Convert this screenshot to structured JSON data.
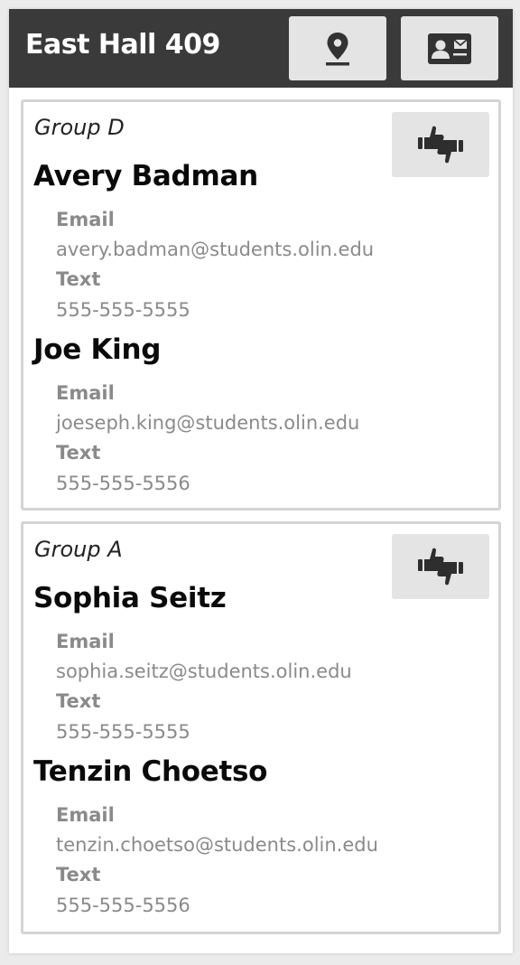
{
  "header": {
    "title": "East Hall 409",
    "buttons": [
      {
        "icon": "location-pin-icon"
      },
      {
        "icon": "contact-card-icon"
      }
    ]
  },
  "groups": [
    {
      "label": "Group D",
      "vote_icon": "thumbs-up-down-icon",
      "members": [
        {
          "name": "Avery Badman",
          "email_label": "Email",
          "email": "avery.badman@students.olin.edu",
          "text_label": "Text",
          "phone": "555-555-5555"
        },
        {
          "name": "Joe King",
          "email_label": "Email",
          "email": "joeseph.king@students.olin.edu",
          "text_label": "Text",
          "phone": "555-555-5556"
        }
      ]
    },
    {
      "label": "Group A",
      "vote_icon": "thumbs-up-down-icon",
      "members": [
        {
          "name": "Sophia Seitz",
          "email_label": "Email",
          "email": "sophia.seitz@students.olin.edu",
          "text_label": "Text",
          "phone": "555-555-5555"
        },
        {
          "name": "Tenzin Choetso",
          "email_label": "Email",
          "email": "tenzin.choetso@students.olin.edu",
          "text_label": "Text",
          "phone": "555-555-5556"
        }
      ]
    }
  ],
  "colors": {
    "header_bg": "#3a3a3a",
    "button_bg": "#e4e4e4",
    "muted_text": "#8a8a8a",
    "card_border": "#d4d4d4"
  }
}
